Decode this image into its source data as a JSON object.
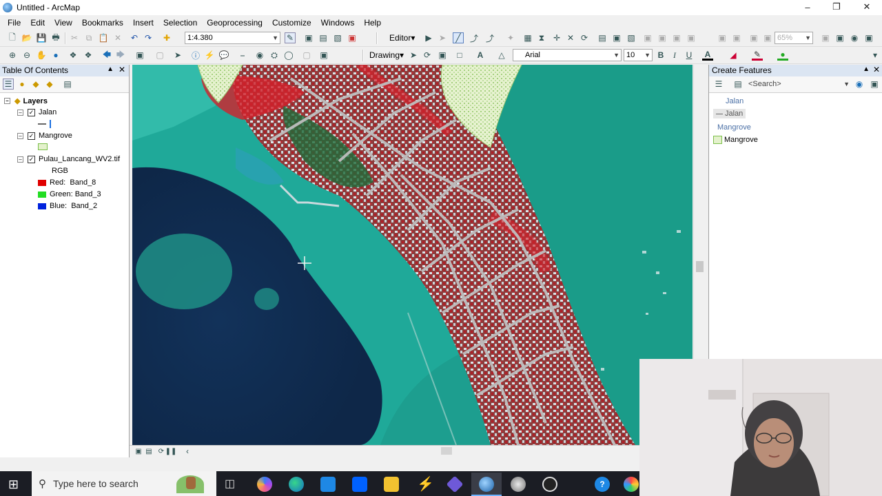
{
  "window": {
    "title": "Untitled - ArcMap"
  },
  "menu": [
    "File",
    "Edit",
    "View",
    "Bookmarks",
    "Insert",
    "Selection",
    "Geoprocessing",
    "Customize",
    "Windows",
    "Help"
  ],
  "toolbar": {
    "scale": "1:4.380",
    "editor_label": "Editor",
    "drawing_label": "Drawing",
    "font_name": "Arial",
    "font_size": "10",
    "zoom_percent": "65%",
    "bold": "B",
    "italic": "I",
    "underline": "U",
    "text_tool": "A"
  },
  "toc": {
    "title": "Table Of Contents",
    "root": "Layers",
    "layers": [
      {
        "name": "Jalan",
        "checked": true
      },
      {
        "name": "Mangrove",
        "checked": true
      },
      {
        "name": "Pulau_Lancang_WV2.tif",
        "checked": true,
        "mode": "RGB",
        "bands": [
          {
            "label": "Red:",
            "band": "Band_8",
            "color": "#e00000"
          },
          {
            "label": "Green:",
            "band": "Band_3",
            "color": "#22dd22"
          },
          {
            "label": "Blue:",
            "band": "Band_2",
            "color": "#0022dd"
          }
        ]
      }
    ]
  },
  "create_features": {
    "title": "Create Features",
    "search_placeholder": "<Search>",
    "groups": [
      {
        "group": "Jalan",
        "template": "Jalan"
      },
      {
        "group": "Mangrove",
        "template": "Mangrove"
      }
    ]
  },
  "taskbar": {
    "search_placeholder": "Type here to search"
  },
  "colors": {
    "panel_header": "#dbe5f2",
    "taskbar": "#1b1d24",
    "water_deep": "#0f2a4d",
    "water_shallow": "#1fa999",
    "vegetation_red": "#d3212b"
  }
}
